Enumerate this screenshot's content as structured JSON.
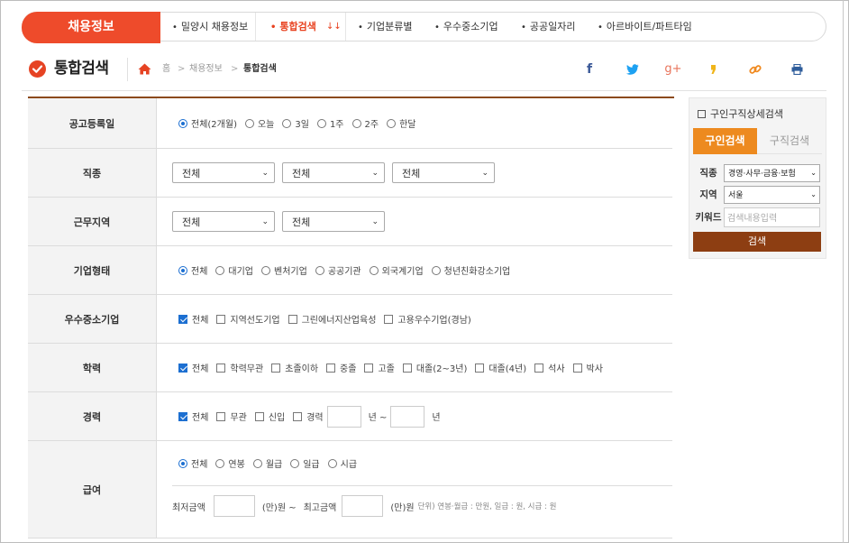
{
  "nav": {
    "brand": "채용정보",
    "items": [
      {
        "label": "밀양시 채용정보"
      },
      {
        "label": "통합검색"
      },
      {
        "label": "기업분류별"
      },
      {
        "label": "우수중소기업"
      },
      {
        "label": "공공일자리"
      },
      {
        "label": "아르바이트/파트타임"
      }
    ]
  },
  "title": {
    "text": "통합검색",
    "breadcrumb": [
      "홈",
      "채용정보",
      "통합검색"
    ]
  },
  "form": {
    "posting_date": {
      "label": "공고등록일",
      "options": [
        "전체(2개월)",
        "오늘",
        "3일",
        "1주",
        "2주",
        "한달"
      ],
      "selected": "전체(2개월)"
    },
    "job_type": {
      "label": "직종",
      "selects": [
        "전체",
        "전체",
        "전체"
      ]
    },
    "work_area": {
      "label": "근무지역",
      "selects": [
        "전체",
        "전체"
      ]
    },
    "company_type": {
      "label": "기업형태",
      "options": [
        "전체",
        "대기업",
        "벤처기업",
        "공공기관",
        "외국계기업",
        "청년친화강소기업"
      ],
      "selected": "전체"
    },
    "sme": {
      "label": "우수중소기업",
      "options": [
        "전체",
        "지역선도기업",
        "그린에너지산업육성",
        "고용우수기업(경남)"
      ],
      "checked": [
        "전체"
      ]
    },
    "education": {
      "label": "학력",
      "options": [
        "전체",
        "학력무관",
        "초졸이하",
        "중졸",
        "고졸",
        "대졸(2~3년)",
        "대졸(4년)",
        "석사",
        "박사"
      ],
      "checked": [
        "전체"
      ]
    },
    "career": {
      "label": "경력",
      "options": [
        "전체",
        "무관",
        "신입",
        "경력"
      ],
      "checked": [
        "전체"
      ],
      "from_unit": "년 ~",
      "to_unit": "년"
    },
    "salary": {
      "label": "급여",
      "options": [
        "전체",
        "연봉",
        "월급",
        "일급",
        "시급"
      ],
      "selected": "전체",
      "min_label": "최저금액",
      "max_label": "최고금액",
      "unit_min": "(만)원 ~",
      "unit_max": "(만)원",
      "note": "단위) 연봉·월급 : 만원, 일급 : 원, 시급 : 원"
    }
  },
  "side": {
    "title": "구인구직상세검색",
    "tab_active": "구인검색",
    "tab_inactive": "구직검색",
    "job_label": "직종",
    "job_value": "경영·사무·금융·보험",
    "area_label": "지역",
    "area_value": "서울",
    "keyword_label": "키워드",
    "keyword_placeholder": "검색내용입력",
    "search_button": "검색"
  },
  "colors": {
    "brand_red": "#ee4b2b",
    "accent_orange": "#ed8a1f",
    "dark_brown": "#8d3e12",
    "checkbox_blue": "#1c6fd1"
  }
}
